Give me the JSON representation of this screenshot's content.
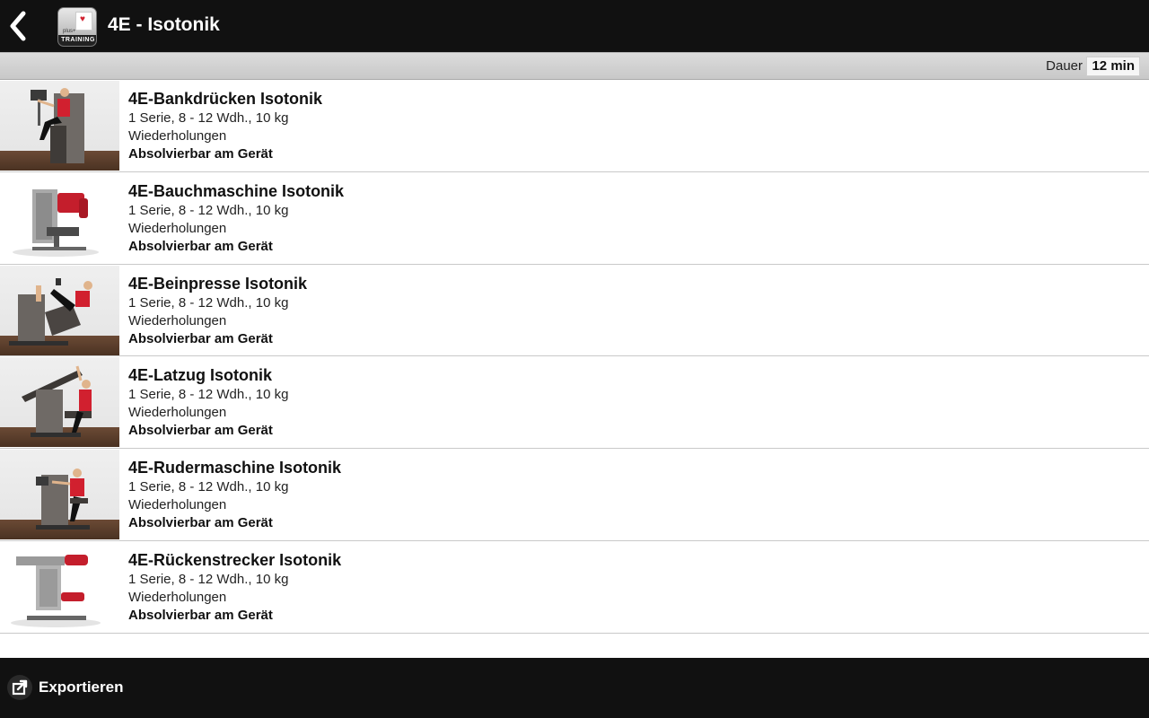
{
  "header": {
    "title": "4E - Isotonik",
    "back_icon": "chevron-left-icon",
    "app_icon_label": "TRAINING"
  },
  "duration": {
    "label": "Dauer",
    "value": "12 min"
  },
  "exercises": [
    {
      "name": "4E-Bankdrücken Isotonik",
      "sets": "1 Serie, 8 - 12 Wdh., 10 kg",
      "reps_label": "Wiederholungen",
      "note": "Absolvierbar am Gerät"
    },
    {
      "name": "4E-Bauchmaschine Isotonik",
      "sets": "1 Serie, 8 - 12 Wdh., 10 kg",
      "reps_label": "Wiederholungen",
      "note": "Absolvierbar am Gerät"
    },
    {
      "name": "4E-Beinpresse Isotonik",
      "sets": "1 Serie, 8 - 12 Wdh., 10 kg",
      "reps_label": "Wiederholungen",
      "note": "Absolvierbar am Gerät"
    },
    {
      "name": "4E-Latzug Isotonik",
      "sets": "1 Serie, 8 - 12 Wdh., 10 kg",
      "reps_label": "Wiederholungen",
      "note": "Absolvierbar am Gerät"
    },
    {
      "name": "4E-Rudermaschine Isotonik",
      "sets": "1 Serie, 8 - 12 Wdh., 10 kg",
      "reps_label": "Wiederholungen",
      "note": "Absolvierbar am Gerät"
    },
    {
      "name": "4E-Rückenstrecker Isotonik",
      "sets": "1 Serie, 8 - 12 Wdh., 10 kg",
      "reps_label": "Wiederholungen",
      "note": "Absolvierbar am Gerät"
    }
  ],
  "footer": {
    "export_label": "Exportieren",
    "export_icon": "share-export-icon"
  },
  "colors": {
    "bars": "#111111",
    "accent_red": "#d1202f"
  }
}
